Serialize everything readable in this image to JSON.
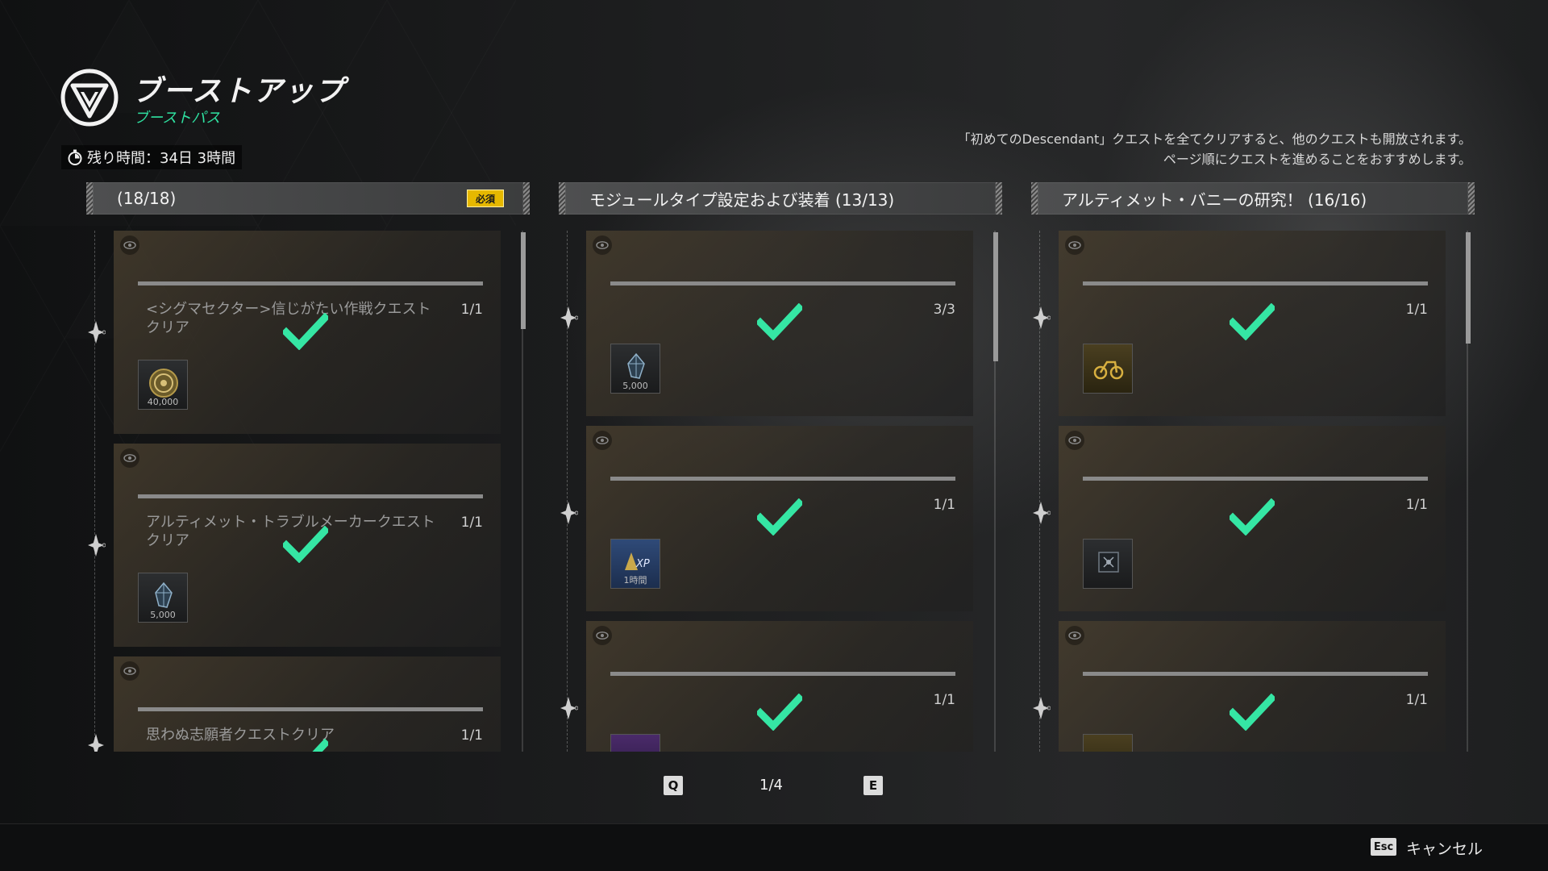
{
  "header": {
    "title": "ブーストアップ",
    "subtitle": "ブーストパス",
    "timer": "残り時間：34日 3時間",
    "notice_lines": [
      "「初めてのDescendant」クエストを全てクリアすると、他のクエストも開放されます。",
      "ページ順にクエストを進めることをおすすめします。"
    ]
  },
  "columns": [
    {
      "title": "(18/18)",
      "badge": "必須",
      "quests": [
        {
          "name": "<シグマセクター>信じがたい作戦クエストクリア",
          "count": "1/1",
          "progress": 1.0,
          "completed": true,
          "reward_icon": "coin-icon",
          "reward_amount": "40,000"
        },
        {
          "name": "アルティメット・トラブルメーカークエストクリア",
          "count": "1/1",
          "progress": 1.0,
          "completed": true,
          "reward_icon": "crystal-icon",
          "reward_amount": "5,000"
        },
        {
          "name": "思わぬ志願者クエストクリア",
          "count": "1/1",
          "progress": 1.0,
          "completed": true,
          "reward_icon": "",
          "reward_amount": ""
        }
      ]
    },
    {
      "title": "モジュールタイプ設定および装着 (13/13)",
      "badge": "",
      "quests": [
        {
          "name": "",
          "count": "3/3",
          "progress": 1.0,
          "completed": true,
          "reward_icon": "crystal-icon",
          "reward_amount": "5,000"
        },
        {
          "name": "",
          "count": "1/1",
          "progress": 1.0,
          "completed": true,
          "reward_icon": "xp-boost-icon",
          "reward_amount": "1時間"
        },
        {
          "name": "",
          "count": "1/1",
          "progress": 1.0,
          "completed": true,
          "reward_icon": "",
          "reward_amount": ""
        }
      ]
    },
    {
      "title": "アルティメット・バニーの研究！ (16/16)",
      "badge": "",
      "quests": [
        {
          "name": "",
          "count": "1/1",
          "progress": 1.0,
          "completed": true,
          "reward_icon": "motorcycle-icon",
          "reward_amount": ""
        },
        {
          "name": "",
          "count": "1/1",
          "progress": 1.0,
          "completed": true,
          "reward_icon": "module-icon",
          "reward_amount": ""
        },
        {
          "name": "",
          "count": "1/1",
          "progress": 1.0,
          "completed": true,
          "reward_icon": "",
          "reward_amount": ""
        }
      ]
    }
  ],
  "pagination": {
    "prev_key": "Q",
    "next_key": "E",
    "page": "1/4"
  },
  "footer": {
    "esc_key": "Esc",
    "cancel_label": "キャンセル"
  },
  "colors": {
    "accent_green": "#2fe0a0",
    "check_green": "#35e6a4",
    "badge_yellow": "#e6b800"
  }
}
